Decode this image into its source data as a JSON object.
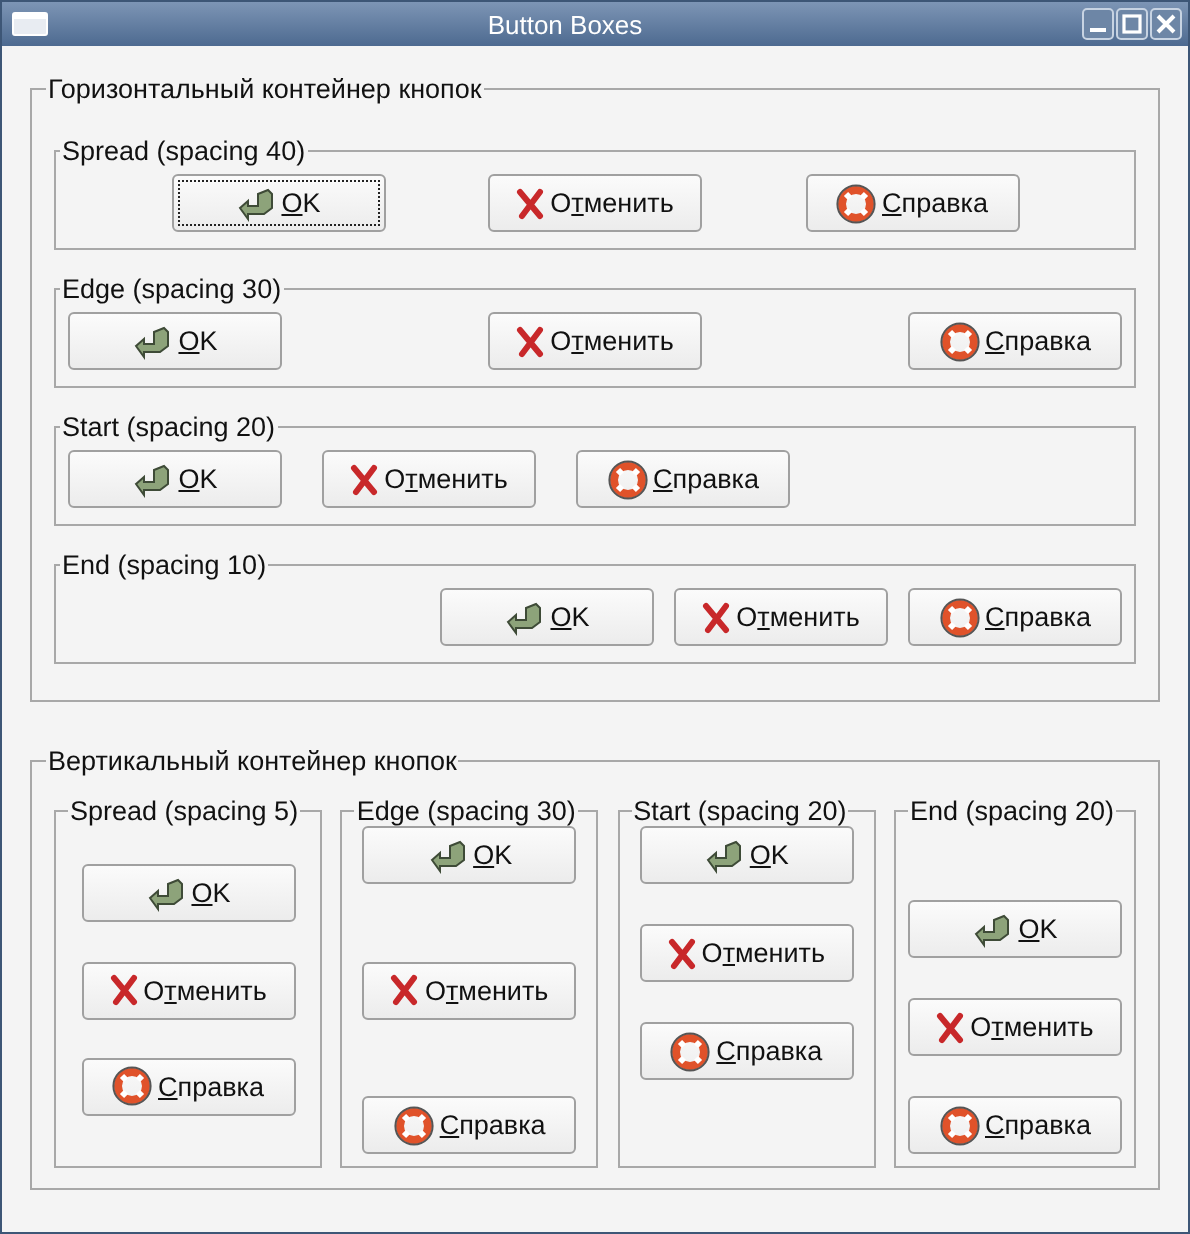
{
  "window": {
    "title": "Button Boxes"
  },
  "horizontal": {
    "title": "Горизонтальный контейнер кнопок",
    "boxes": [
      {
        "title": "Spread (spacing 40)",
        "kind": "spread",
        "buttons": [
          {
            "kind": "ok",
            "label": "OK",
            "focused": true
          },
          {
            "kind": "cancel",
            "label": "Отменить",
            "focused": false
          },
          {
            "kind": "help",
            "label": "Справка",
            "focused": false
          }
        ]
      },
      {
        "title": "Edge (spacing 30)",
        "kind": "edge",
        "buttons": [
          {
            "kind": "ok",
            "label": "OK",
            "focused": false
          },
          {
            "kind": "cancel",
            "label": "Отменить",
            "focused": false
          },
          {
            "kind": "help",
            "label": "Справка",
            "focused": false
          }
        ]
      },
      {
        "title": "Start (spacing 20)",
        "kind": "start",
        "buttons": [
          {
            "kind": "ok",
            "label": "OK",
            "focused": false
          },
          {
            "kind": "cancel",
            "label": "Отменить",
            "focused": false
          },
          {
            "kind": "help",
            "label": "Справка",
            "focused": false
          }
        ]
      },
      {
        "title": "End (spacing 10)",
        "kind": "end",
        "buttons": [
          {
            "kind": "ok",
            "label": "OK",
            "focused": false
          },
          {
            "kind": "cancel",
            "label": "Отменить",
            "focused": false
          },
          {
            "kind": "help",
            "label": "Справка",
            "focused": false
          }
        ]
      }
    ]
  },
  "vertical": {
    "title": "Вертикальный контейнер кнопок",
    "boxes": [
      {
        "title": "Spread (spacing 5)",
        "kind": "spread",
        "buttons": [
          {
            "kind": "ok",
            "label": "OK",
            "focused": false
          },
          {
            "kind": "cancel",
            "label": "Отменить",
            "focused": false
          },
          {
            "kind": "help",
            "label": "Справка",
            "focused": false
          }
        ]
      },
      {
        "title": "Edge (spacing 30)",
        "kind": "edge",
        "buttons": [
          {
            "kind": "ok",
            "label": "OK",
            "focused": false
          },
          {
            "kind": "cancel",
            "label": "Отменить",
            "focused": false
          },
          {
            "kind": "help",
            "label": "Справка",
            "focused": false
          }
        ]
      },
      {
        "title": "Start (spacing 20)",
        "kind": "start",
        "buttons": [
          {
            "kind": "ok",
            "label": "OK",
            "focused": false
          },
          {
            "kind": "cancel",
            "label": "Отменить",
            "focused": false
          },
          {
            "kind": "help",
            "label": "Справка",
            "focused": false
          }
        ]
      },
      {
        "title": "End (spacing 20)",
        "kind": "end",
        "buttons": [
          {
            "kind": "ok",
            "label": "OK",
            "focused": false
          },
          {
            "kind": "cancel",
            "label": "Отменить",
            "focused": false
          },
          {
            "kind": "help",
            "label": "Справка",
            "focused": false
          }
        ]
      }
    ]
  }
}
